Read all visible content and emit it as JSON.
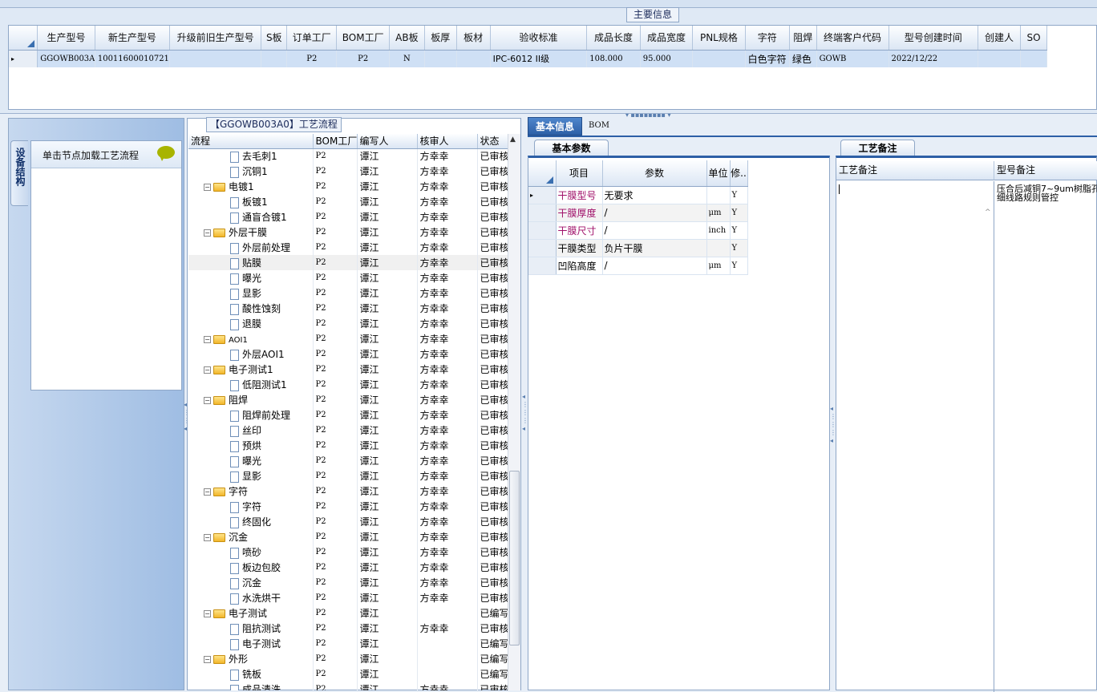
{
  "main": {
    "title": "主要信息",
    "columns": [
      "生产型号",
      "新生产型号",
      "升级前旧生产型号",
      "S板",
      "订单工厂",
      "BOM工厂",
      "AB板",
      "板厚",
      "板材",
      "验收标准",
      "成品长度",
      "成品宽度",
      "PNL规格",
      "字符",
      "阻焊",
      "终端客户代码",
      "型号创建时间",
      "创建人",
      "SO"
    ],
    "row": [
      "GGOWB003A0",
      "10011600010721",
      "",
      "",
      "P2",
      "P2",
      "N",
      "",
      "",
      "IPC-6012 II级",
      "108.000",
      "95.000",
      "",
      "白色字符",
      "绿色",
      "GOWB",
      "2022/12/22",
      "",
      ""
    ],
    "row_marker": "▸"
  },
  "left": {
    "tab_label": "设备结构",
    "load_text": "单击节点加载工艺流程"
  },
  "flow": {
    "title": "【GGOWB003A0】工艺流程",
    "columns": [
      "流程",
      "BOM工厂",
      "编写人",
      "核审人",
      "状态"
    ],
    "rows": [
      {
        "name": "去毛刺1",
        "type": "doc",
        "level": 1,
        "bom": "P2",
        "writer": "谭江",
        "reviewer": "方幸幸",
        "status": "已审核"
      },
      {
        "name": "沉铜1",
        "type": "doc",
        "level": 1,
        "bom": "P2",
        "writer": "谭江",
        "reviewer": "方幸幸",
        "status": "已审核"
      },
      {
        "name": "电镀1",
        "type": "folder",
        "level": 0,
        "bom": "P2",
        "writer": "谭江",
        "reviewer": "方幸幸",
        "status": "已审核"
      },
      {
        "name": "板镀1",
        "type": "doc",
        "level": 1,
        "bom": "P2",
        "writer": "谭江",
        "reviewer": "方幸幸",
        "status": "已审核"
      },
      {
        "name": "通盲合镀1",
        "type": "doc",
        "level": 1,
        "bom": "P2",
        "writer": "谭江",
        "reviewer": "方幸幸",
        "status": "已审核"
      },
      {
        "name": "外层干膜",
        "type": "folder",
        "level": 0,
        "bom": "P2",
        "writer": "谭江",
        "reviewer": "方幸幸",
        "status": "已审核"
      },
      {
        "name": "外层前处理",
        "type": "doc",
        "level": 1,
        "bom": "P2",
        "writer": "谭江",
        "reviewer": "方幸幸",
        "status": "已审核"
      },
      {
        "name": "贴膜",
        "type": "doc",
        "level": 1,
        "bom": "P2",
        "writer": "谭江",
        "reviewer": "方幸幸",
        "status": "已审核",
        "selected": true
      },
      {
        "name": "曝光",
        "type": "doc",
        "level": 1,
        "bom": "P2",
        "writer": "谭江",
        "reviewer": "方幸幸",
        "status": "已审核"
      },
      {
        "name": "显影",
        "type": "doc",
        "level": 1,
        "bom": "P2",
        "writer": "谭江",
        "reviewer": "方幸幸",
        "status": "已审核"
      },
      {
        "name": "酸性蚀刻",
        "type": "doc",
        "level": 1,
        "bom": "P2",
        "writer": "谭江",
        "reviewer": "方幸幸",
        "status": "已审核"
      },
      {
        "name": "退膜",
        "type": "doc",
        "level": 1,
        "bom": "P2",
        "writer": "谭江",
        "reviewer": "方幸幸",
        "status": "已审核"
      },
      {
        "name": "AOI1",
        "type": "folder",
        "level": 0,
        "bom": "P2",
        "writer": "谭江",
        "reviewer": "方幸幸",
        "status": "已审核"
      },
      {
        "name": "外层AOI1",
        "type": "doc",
        "level": 1,
        "bom": "P2",
        "writer": "谭江",
        "reviewer": "方幸幸",
        "status": "已审核"
      },
      {
        "name": "电子测试1",
        "type": "folder",
        "level": 0,
        "bom": "P2",
        "writer": "谭江",
        "reviewer": "方幸幸",
        "status": "已审核"
      },
      {
        "name": "低阻测试1",
        "type": "doc",
        "level": 1,
        "bom": "P2",
        "writer": "谭江",
        "reviewer": "方幸幸",
        "status": "已审核"
      },
      {
        "name": "阻焊",
        "type": "folder",
        "level": 0,
        "bom": "P2",
        "writer": "谭江",
        "reviewer": "方幸幸",
        "status": "已审核"
      },
      {
        "name": "阻焊前处理",
        "type": "doc",
        "level": 1,
        "bom": "P2",
        "writer": "谭江",
        "reviewer": "方幸幸",
        "status": "已审核"
      },
      {
        "name": "丝印",
        "type": "doc",
        "level": 1,
        "bom": "P2",
        "writer": "谭江",
        "reviewer": "方幸幸",
        "status": "已审核"
      },
      {
        "name": "预烘",
        "type": "doc",
        "level": 1,
        "bom": "P2",
        "writer": "谭江",
        "reviewer": "方幸幸",
        "status": "已审核"
      },
      {
        "name": "曝光",
        "type": "doc",
        "level": 1,
        "bom": "P2",
        "writer": "谭江",
        "reviewer": "方幸幸",
        "status": "已审核"
      },
      {
        "name": "显影",
        "type": "doc",
        "level": 1,
        "bom": "P2",
        "writer": "谭江",
        "reviewer": "方幸幸",
        "status": "已审核"
      },
      {
        "name": "字符",
        "type": "folder",
        "level": 0,
        "bom": "P2",
        "writer": "谭江",
        "reviewer": "方幸幸",
        "status": "已审核"
      },
      {
        "name": "字符",
        "type": "doc",
        "level": 1,
        "bom": "P2",
        "writer": "谭江",
        "reviewer": "方幸幸",
        "status": "已审核"
      },
      {
        "name": "终固化",
        "type": "doc",
        "level": 1,
        "bom": "P2",
        "writer": "谭江",
        "reviewer": "方幸幸",
        "status": "已审核"
      },
      {
        "name": "沉金",
        "type": "folder",
        "level": 0,
        "bom": "P2",
        "writer": "谭江",
        "reviewer": "方幸幸",
        "status": "已审核"
      },
      {
        "name": "喷砂",
        "type": "doc",
        "level": 1,
        "bom": "P2",
        "writer": "谭江",
        "reviewer": "方幸幸",
        "status": "已审核"
      },
      {
        "name": "板边包胶",
        "type": "doc",
        "level": 1,
        "bom": "P2",
        "writer": "谭江",
        "reviewer": "方幸幸",
        "status": "已审核"
      },
      {
        "name": "沉金",
        "type": "doc",
        "level": 1,
        "bom": "P2",
        "writer": "谭江",
        "reviewer": "方幸幸",
        "status": "已审核"
      },
      {
        "name": "水洗烘干",
        "type": "doc",
        "level": 1,
        "bom": "P2",
        "writer": "谭江",
        "reviewer": "方幸幸",
        "status": "已审核"
      },
      {
        "name": "电子测试",
        "type": "folder",
        "level": 0,
        "bom": "P2",
        "writer": "谭江",
        "reviewer": "",
        "status": "已编写"
      },
      {
        "name": "阻抗测试",
        "type": "doc",
        "level": 1,
        "bom": "P2",
        "writer": "谭江",
        "reviewer": "方幸幸",
        "status": "已审核"
      },
      {
        "name": "电子测试",
        "type": "doc",
        "level": 1,
        "bom": "P2",
        "writer": "谭江",
        "reviewer": "",
        "status": "已编写"
      },
      {
        "name": "外形",
        "type": "folder",
        "level": 0,
        "bom": "P2",
        "writer": "谭江",
        "reviewer": "",
        "status": "已编写"
      },
      {
        "name": "铣板",
        "type": "doc",
        "level": 1,
        "bom": "P2",
        "writer": "谭江",
        "reviewer": "",
        "status": "已编写"
      },
      {
        "name": "成品清洗",
        "type": "doc",
        "level": 1,
        "bom": "P2",
        "writer": "谭江",
        "reviewer": "方幸幸",
        "status": "已审核"
      }
    ]
  },
  "tabs": {
    "basic": "基本信息",
    "bom": "BOM"
  },
  "params": {
    "tab": "基本参数",
    "columns": [
      "项目",
      "参数",
      "单位",
      "修.."
    ],
    "rows": [
      {
        "item": "干膜型号",
        "value": "无要求",
        "unit": "",
        "mod": "Y",
        "highlight": true,
        "marker": "▸"
      },
      {
        "item": "干膜厚度",
        "value": "/",
        "unit": "μm",
        "mod": "Y",
        "highlight": true,
        "marker": ""
      },
      {
        "item": "干膜尺寸",
        "value": "/",
        "unit": "inch",
        "mod": "Y",
        "highlight": true,
        "marker": ""
      },
      {
        "item": "干膜类型",
        "value": "负片干膜",
        "unit": "",
        "mod": "Y",
        "highlight": false,
        "marker": ""
      },
      {
        "item": "凹陷高度",
        "value": "/",
        "unit": "μm",
        "mod": "Y",
        "highlight": false,
        "marker": ""
      }
    ],
    "highlight_color": "#a0116a"
  },
  "notes": {
    "tab": "工艺备注",
    "col1": "工艺备注",
    "col2": "型号备注",
    "model_note_line1": "压合后减铜7~9um树脂孔",
    "model_note_line2": "细线路规则管控"
  }
}
